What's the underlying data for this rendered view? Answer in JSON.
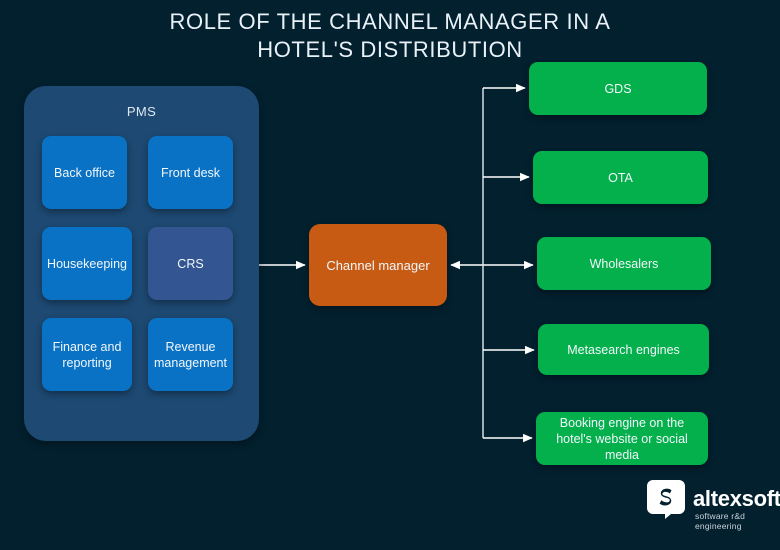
{
  "page": {
    "title": "ROLE OF THE CHANNEL MANAGER IN A\nHOTEL'S DISTRIBUTION",
    "background_color": "#03202f"
  },
  "colors": {
    "background": "#03202f",
    "panel_blue": "#1d4972",
    "tile_blue": "#0a72c4",
    "tile_crs": "#335591",
    "hub_orange": "#c85b13",
    "channel_green": "#04b04c",
    "connector": "#ffffff",
    "title_text": "#e9f2f7"
  },
  "pms_panel": {
    "label": "PMS",
    "tiles": [
      {
        "label": "Back office",
        "color": "#0a72c4"
      },
      {
        "label": "Front desk",
        "color": "#0a72c4"
      },
      {
        "label": "Housekeeping",
        "color": "#0a72c4"
      },
      {
        "label": "CRS",
        "color": "#335591"
      },
      {
        "label": "Finance and reporting",
        "color": "#0a72c4"
      },
      {
        "label": "Revenue management",
        "color": "#0a72c4"
      }
    ]
  },
  "hub": {
    "label": "Channel manager",
    "color": "#c85b13"
  },
  "channels": [
    {
      "label": "GDS",
      "color": "#04b04c"
    },
    {
      "label": "OTA",
      "color": "#04b04c"
    },
    {
      "label": "Wholesalers",
      "color": "#04b04c"
    },
    {
      "label": "Metasearch engines",
      "color": "#04b04c"
    },
    {
      "label": "Booking engine on the hotel's website or social media",
      "color": "#04b04c"
    }
  ],
  "logo": {
    "name": "altexsoft",
    "tagline": "software r&d engineering"
  }
}
